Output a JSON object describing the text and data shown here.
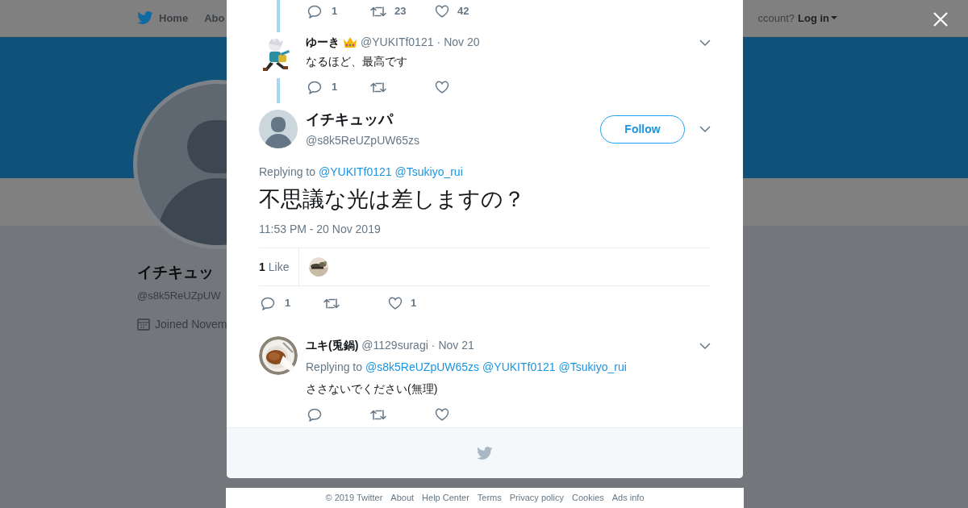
{
  "page": {
    "nav": [
      {
        "label": "Home"
      },
      {
        "label": "Abo"
      }
    ],
    "account_prompt": "ccount?",
    "login": "Log in",
    "profile": {
      "name": "イチキュッ",
      "handle": "@s8k5ReUZpUW",
      "joined": "Joined Novem"
    },
    "footer_links": [
      "© 2019 Twitter",
      "About",
      "Help Center",
      "Terms",
      "Privacy policy",
      "Cookies",
      "Ads info"
    ]
  },
  "modal": {
    "thread": [
      {
        "kind": "stub",
        "actions": {
          "replies": "1",
          "retweets": "23",
          "likes": "42"
        }
      },
      {
        "kind": "tweet",
        "name": "ゆーき",
        "handle": "@YUKITf0121",
        "separator": "·",
        "date": "Nov 20",
        "text": "なるほど、最高です",
        "actions": {
          "replies": "1"
        }
      }
    ],
    "main": {
      "name": "イチキュッパ",
      "handle": "@s8k5ReUZpUW65zs",
      "follow": "Follow",
      "replying_prefix": "Replying to",
      "mentions": [
        "@YUKITf0121",
        "@Tsukiyo_rui"
      ],
      "text": "不思議な光は差しますの？",
      "timestamp": "11:53 PM - 20 Nov 2019",
      "likes_count": "1",
      "likes_label": "Like",
      "actions": {
        "replies": "1",
        "likes": "1"
      }
    },
    "replies": [
      {
        "name": "ユキ(兎鍋)",
        "handle": "@1129suragi",
        "separator": "·",
        "date": "Nov 21",
        "replying_prefix": "Replying to",
        "mentions": [
          "@s8k5ReUZpUW65zs",
          "@YUKITf0121",
          "@Tsukiyo_rui"
        ],
        "text": "ささないでください(無理)"
      }
    ]
  }
}
